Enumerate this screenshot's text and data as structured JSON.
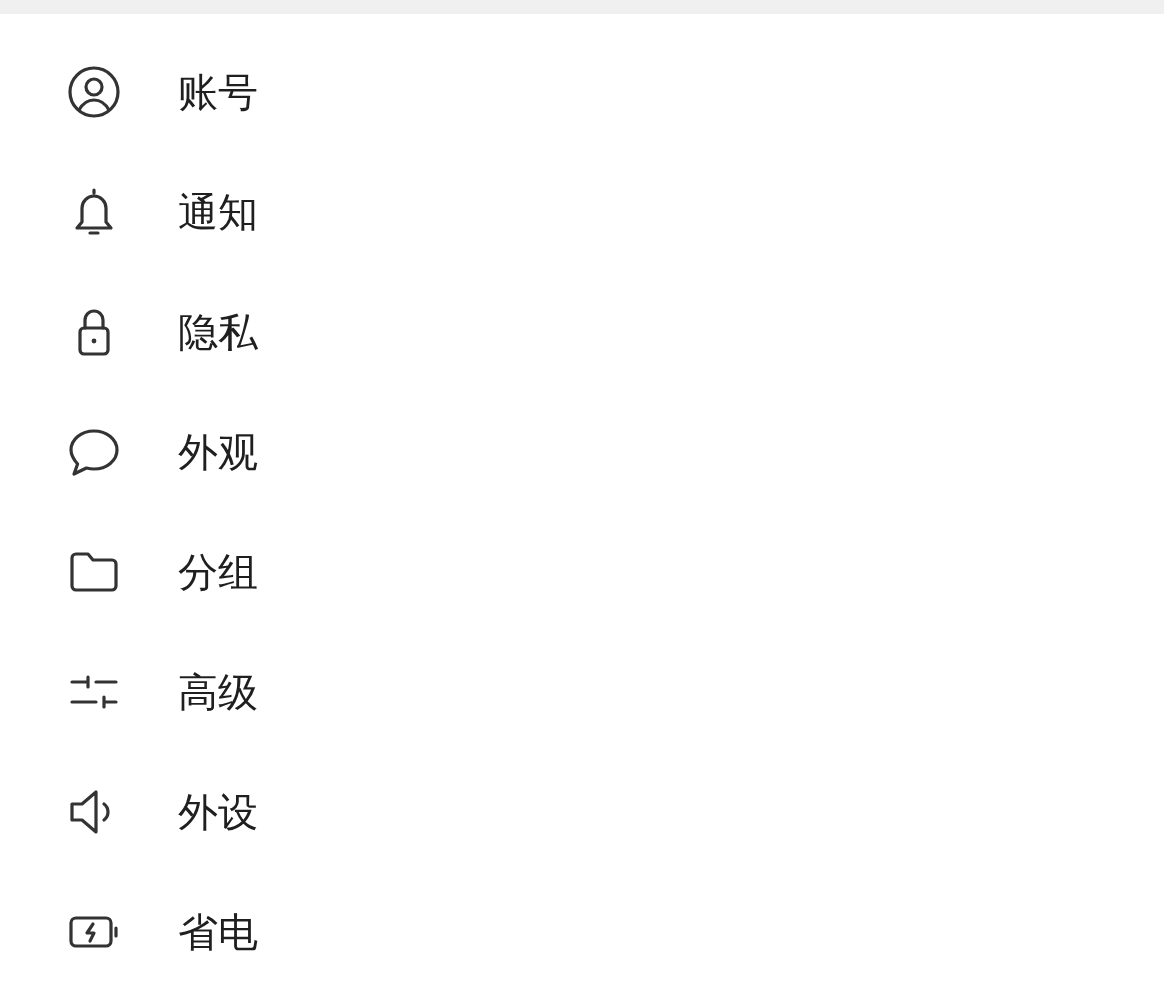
{
  "menu": {
    "items": [
      {
        "label": "账号"
      },
      {
        "label": "通知"
      },
      {
        "label": "隐私"
      },
      {
        "label": "外观"
      },
      {
        "label": "分组"
      },
      {
        "label": "高级"
      },
      {
        "label": "外设"
      },
      {
        "label": "省电"
      }
    ]
  }
}
